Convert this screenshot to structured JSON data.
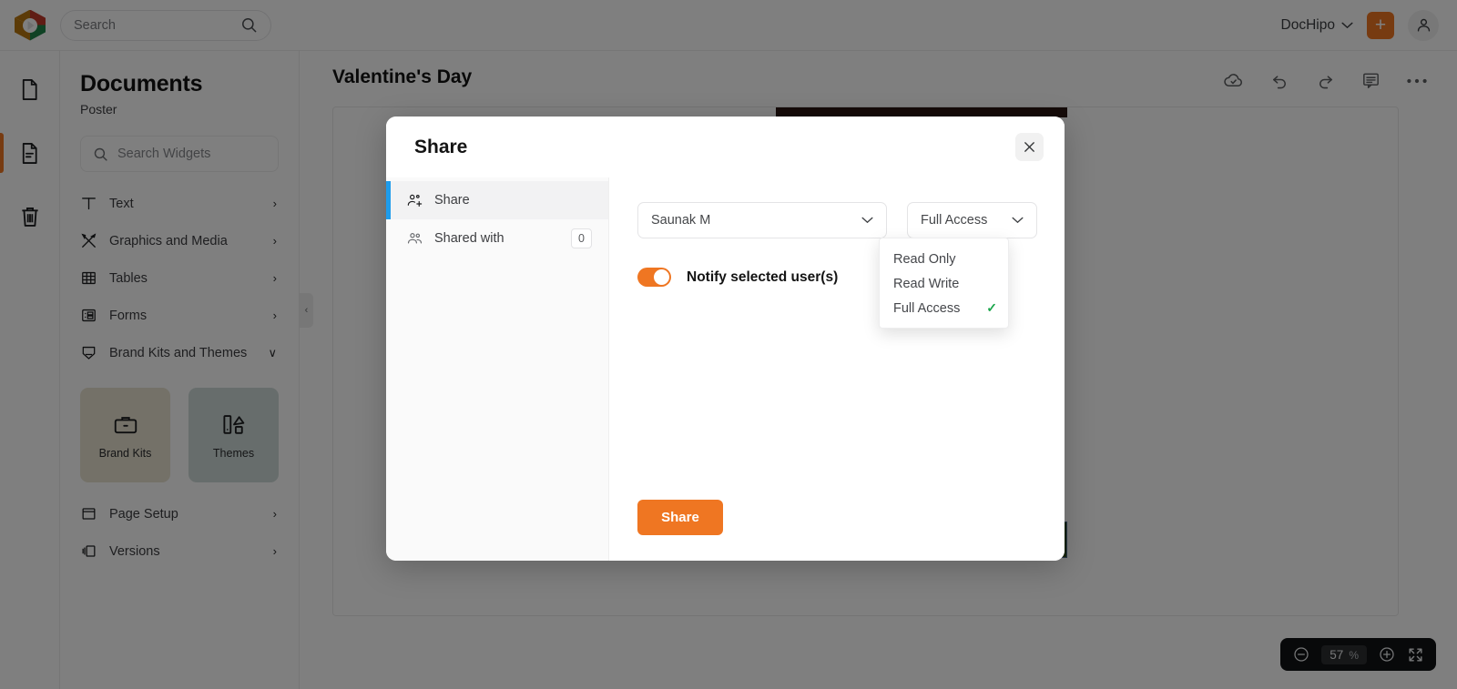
{
  "topbar": {
    "search_placeholder": "Search",
    "brand_name": "DocHipo",
    "add_label": "+"
  },
  "rail": {
    "items": [
      {
        "name": "new-document",
        "icon": "document-icon"
      },
      {
        "name": "my-documents",
        "icon": "document-lines-icon",
        "active": true
      },
      {
        "name": "trash",
        "icon": "trash-icon"
      }
    ]
  },
  "panel": {
    "title": "Documents",
    "subtitle": "Poster",
    "search_placeholder": "Search Widgets",
    "nav": [
      {
        "label": "Text",
        "icon": "text-icon",
        "chevron": "›"
      },
      {
        "label": "Graphics and Media",
        "icon": "graphics-icon",
        "chevron": "›"
      },
      {
        "label": "Tables",
        "icon": "table-icon",
        "chevron": "›"
      },
      {
        "label": "Forms",
        "icon": "form-icon",
        "chevron": "›"
      },
      {
        "label": "Brand Kits and Themes",
        "icon": "brandkit-icon",
        "chevron": "∨"
      }
    ],
    "cards": [
      {
        "label": "Brand Kits",
        "icon": "briefcase-icon",
        "color": "#e8e2d0"
      },
      {
        "label": "Themes",
        "icon": "themes-icon",
        "color": "#cfdbd9"
      }
    ],
    "nav_bottom": [
      {
        "label": "Page Setup",
        "icon": "page-setup-icon",
        "chevron": "›"
      },
      {
        "label": "Versions",
        "icon": "versions-icon",
        "chevron": "›"
      }
    ]
  },
  "document": {
    "title": "Valentine's Day",
    "tools": [
      {
        "name": "cloud-saved-icon"
      },
      {
        "name": "undo-icon"
      },
      {
        "name": "redo-icon"
      },
      {
        "name": "comment-icon"
      },
      {
        "name": "more-options-icon"
      }
    ],
    "collapse_chevron": "‹"
  },
  "zoom": {
    "minus": "−",
    "value": "57",
    "percent": "%",
    "plus": "+",
    "fullscreen": "fullscreen-icon"
  },
  "modal": {
    "title": "Share",
    "close": "×",
    "nav": [
      {
        "label": "Share",
        "icon": "person-add-icon",
        "active": true
      },
      {
        "label": "Shared with",
        "icon": "people-icon",
        "badge": "0"
      }
    ],
    "user_select": {
      "value": "Saunak M",
      "chevron": "∨"
    },
    "permission_select": {
      "value": "Full Access",
      "chevron": "∨"
    },
    "permission_options": [
      {
        "label": "Read Only",
        "selected": false
      },
      {
        "label": "Read Write",
        "selected": false
      },
      {
        "label": "Full Access",
        "selected": true,
        "check": "✓"
      }
    ],
    "notify_label": "Notify selected user(s)",
    "notify_enabled": true,
    "share_button": "Share"
  },
  "colors": {
    "accent_orange": "#ef7622",
    "accent_blue": "#1e9ceb",
    "check_green": "#1aa64b",
    "scrim": "rgba(0,0,0,0.5)"
  }
}
